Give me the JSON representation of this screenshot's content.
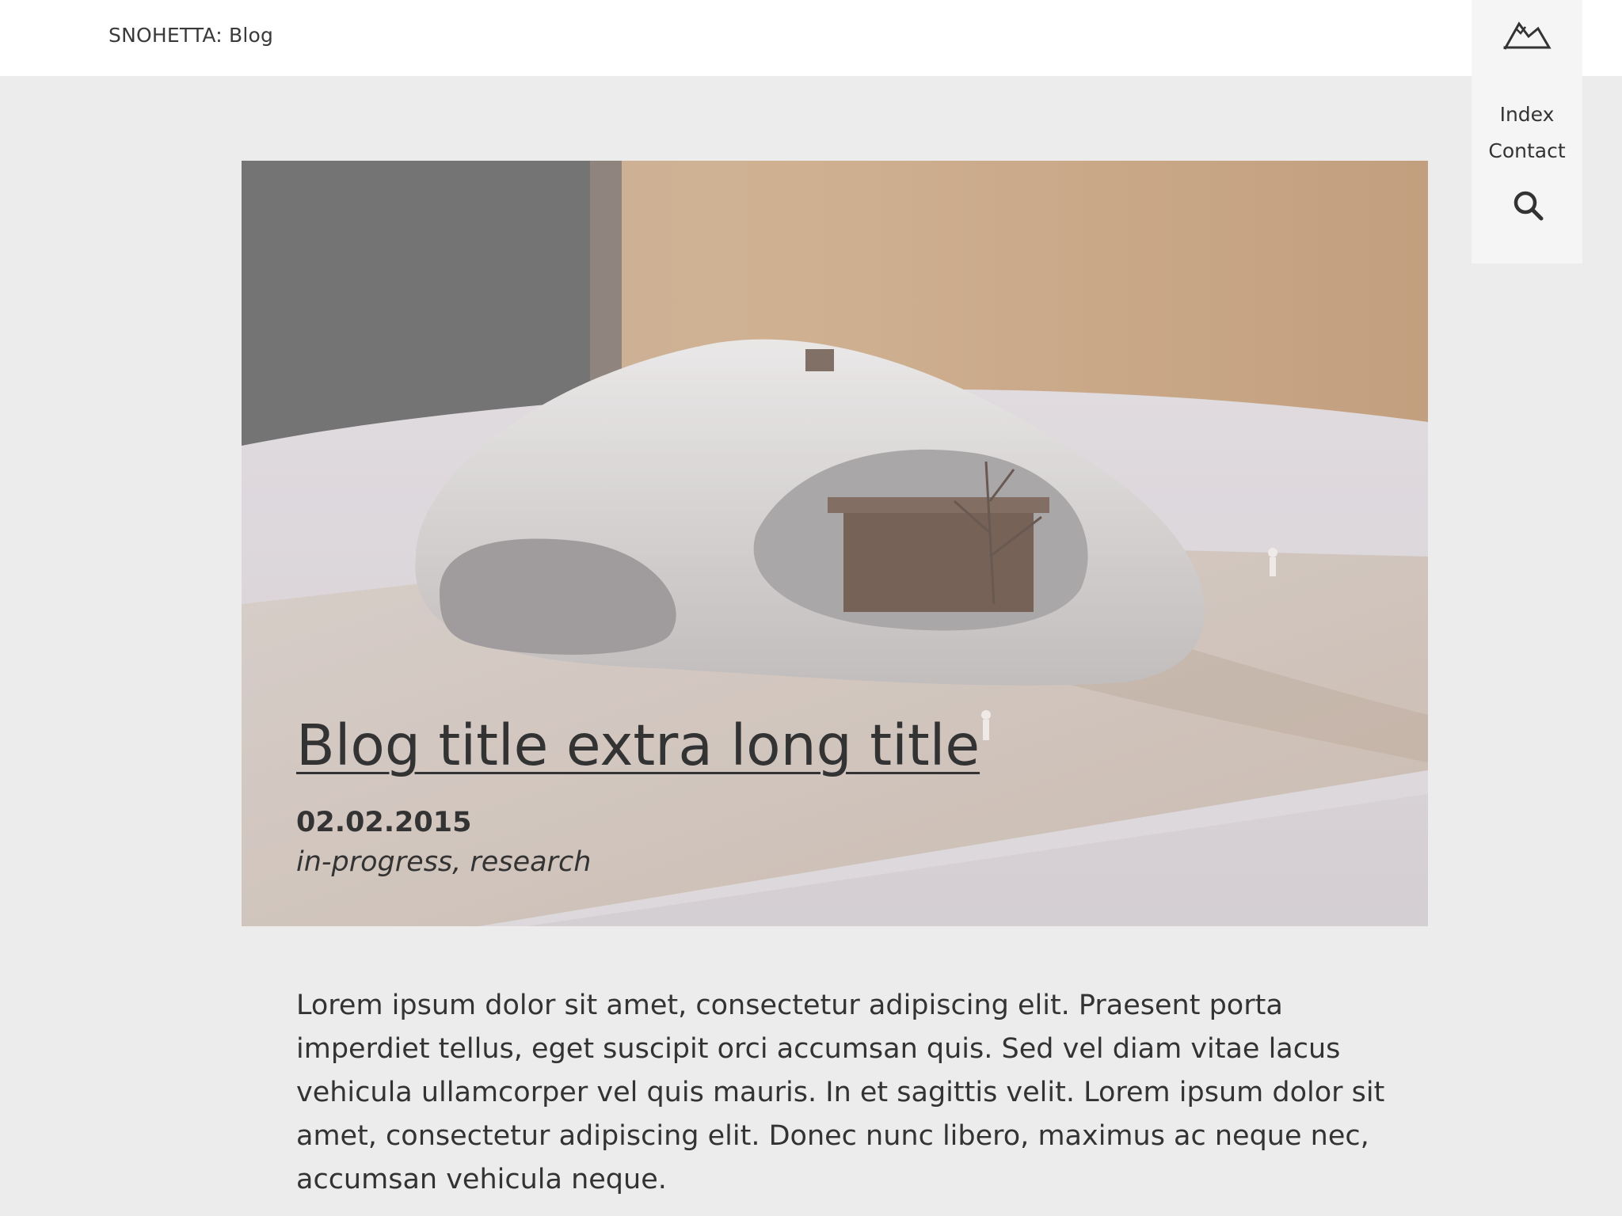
{
  "header": {
    "site_title": "SNOHETTA: Blog"
  },
  "nav": {
    "index_label": "Index",
    "contact_label": "Contact",
    "search_icon": "search-icon",
    "logo_icon": "mountain-logo-icon"
  },
  "post": {
    "title": "Blog title extra long title",
    "date": "02.02.2015",
    "tags": "in-progress, research",
    "body": "Lorem ipsum dolor sit amet, consectetur adipiscing elit. Praesent porta imperdiet tellus, eget suscipit orci accumsan quis. Sed vel diam vitae lacus vehicula ullamcorper vel quis mauris. In et sagittis velit. Lorem ipsum dolor sit amet, consectetur adipiscing elit. Donec nunc libero, maximus ac neque nec, accumsan vehicula neque."
  },
  "colors": {
    "page_bg": "#ececec",
    "header_bg": "#ffffff",
    "side_nav_bg": "#f5f5f5",
    "text": "#333333"
  }
}
